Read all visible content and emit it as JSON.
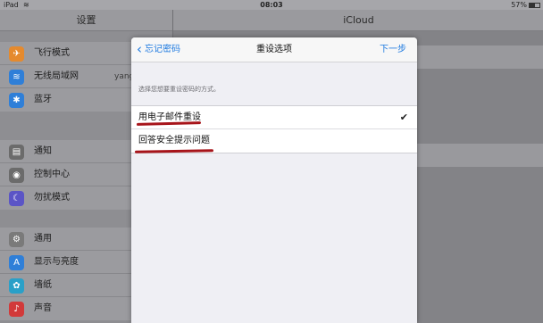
{
  "status_bar": {
    "carrier": "iPad",
    "wifi_icon": "wifi-icon",
    "time": "08:03",
    "battery": "57%",
    "battery_level": 0.57
  },
  "settings": {
    "title": "设置",
    "groups": [
      [
        {
          "icon": "airplane-icon",
          "color": "#e58a2e",
          "glyph": "✈",
          "label": "飞行模式",
          "value": ""
        },
        {
          "icon": "wifi-icon",
          "color": "#2f7fd8",
          "glyph": "≋",
          "label": "无线局域网",
          "value": "yang"
        },
        {
          "icon": "bluetooth-icon",
          "color": "#2f7fd8",
          "glyph": "✱",
          "label": "蓝牙",
          "value": ""
        }
      ],
      [
        {
          "icon": "notifications-icon",
          "color": "#6b6b6b",
          "glyph": "▤",
          "label": "通知",
          "value": ""
        },
        {
          "icon": "control-center-icon",
          "color": "#6b6b6b",
          "glyph": "◉",
          "label": "控制中心",
          "value": ""
        },
        {
          "icon": "do-not-disturb-icon",
          "color": "#5b55c6",
          "glyph": "☾",
          "label": "勿扰模式",
          "value": ""
        }
      ],
      [
        {
          "icon": "general-icon",
          "color": "#7a7a7a",
          "glyph": "⚙",
          "label": "通用",
          "value": ""
        },
        {
          "icon": "display-brightness-icon",
          "color": "#2f7fd8",
          "glyph": "A",
          "label": "显示与亮度",
          "value": ""
        },
        {
          "icon": "wallpaper-icon",
          "color": "#2aa0c8",
          "glyph": "✿",
          "label": "墙纸",
          "value": ""
        },
        {
          "icon": "sounds-icon",
          "color": "#d23a3a",
          "glyph": "♪",
          "label": "声音",
          "value": ""
        }
      ]
    ]
  },
  "detail": {
    "title": "iCloud"
  },
  "modal": {
    "back_label": "忘记密码",
    "title": "重设选项",
    "next_label": "下一步",
    "hint": "选择您想要重设密码的方式。",
    "options": [
      {
        "label": "用电子邮件重设",
        "selected": true
      },
      {
        "label": "回答安全提示问题",
        "selected": false
      }
    ],
    "checkmark": "✔"
  },
  "accent_color": "#1e7ae0",
  "annotation_color": "#a7141a"
}
